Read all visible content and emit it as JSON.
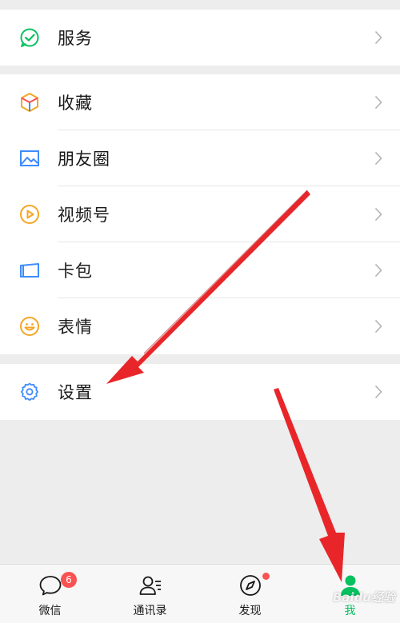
{
  "menu": {
    "service": {
      "label": "服务",
      "icon": "service-icon"
    },
    "items": [
      {
        "label": "收藏",
        "icon": "favorites-cube-icon"
      },
      {
        "label": "朋友圈",
        "icon": "moments-picture-icon"
      },
      {
        "label": "视频号",
        "icon": "channels-play-icon"
      },
      {
        "label": "卡包",
        "icon": "card-wallet-icon"
      },
      {
        "label": "表情",
        "icon": "sticker-smile-icon"
      }
    ],
    "settings": {
      "label": "设置",
      "icon": "gear-icon"
    }
  },
  "tabbar": {
    "tabs": [
      {
        "label": "微信",
        "icon": "chat-bubble-icon",
        "badge": "6"
      },
      {
        "label": "通讯录",
        "icon": "contacts-icon"
      },
      {
        "label": "发现",
        "icon": "compass-icon"
      },
      {
        "label": "我",
        "icon": "me-person-icon"
      }
    ],
    "active_color": "#07c160"
  },
  "colors": {
    "accent": "#07c160",
    "badge": "#fa5151",
    "annotation_arrow": "#e8262a"
  },
  "watermark": "Baidu经验"
}
